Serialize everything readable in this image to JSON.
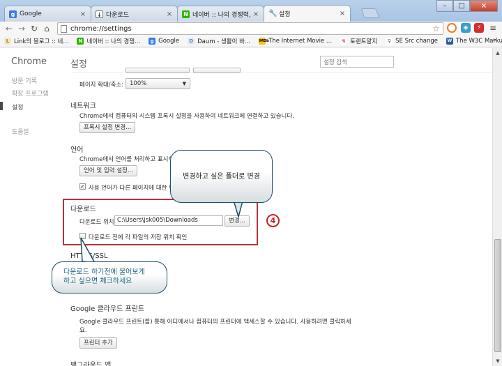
{
  "tabs": [
    {
      "title": "Google",
      "icon": "google-icon"
    },
    {
      "title": "다운로드",
      "icon": "download-icon"
    },
    {
      "title": "네이버 :: 나의 경쟁력, 네",
      "icon": "naver-icon"
    },
    {
      "title": "설정",
      "icon": "wrench-icon"
    }
  ],
  "toolbar": {
    "url": "chrome://settings"
  },
  "bookmarks": [
    {
      "label": "Link의 블로그 :: 네...",
      "icon": "blog-icon"
    },
    {
      "label": "네이버 :: 나의 경쟁...",
      "icon": "naver-icon"
    },
    {
      "label": "Google",
      "icon": "google-icon"
    },
    {
      "label": "Daum - 생활이 바...",
      "icon": "daum-icon"
    },
    {
      "label": "The Internet Movie ...",
      "icon": "imdb-icon"
    },
    {
      "label": "토렌트알지",
      "icon": "torrent-icon"
    },
    {
      "label": "SE Src change",
      "icon": "se-icon"
    },
    {
      "label": "The W3C Markup V...",
      "icon": "w3c-icon"
    }
  ],
  "bookmarks_more": "»",
  "sidebar": {
    "title": "Chrome",
    "items": [
      {
        "label": "방문 기록"
      },
      {
        "label": "확장 프로그램"
      },
      {
        "label": "설정"
      },
      {
        "label": "도움말"
      }
    ]
  },
  "settings": {
    "title": "설정",
    "search_placeholder": "설정 검색",
    "zoom_label": "페이지 확대/축소:",
    "zoom_value": "100%",
    "network": {
      "title": "네트워크",
      "desc": "Chrome에서 컴퓨터의 시스템 프록시 설정을 사용하여 네트워크에 연결하고 있습니다.",
      "button": "프록시 설정 변경..."
    },
    "language": {
      "title": "언어",
      "desc": "Chrome에서 언어를 처리하고 표시하는",
      "button": "언어 및 입력 설정...",
      "translate_label": "사용 언어가 다른 페이지에 대한 번"
    },
    "downloads": {
      "title": "다운로드",
      "location_label": "다운로드 위치:",
      "location_value": "C:\\Users\\jsk005\\Downloads",
      "change_button": "변경...",
      "ask_label": "다운로드 전에 각 파일의 저장 위치 확인"
    },
    "https": {
      "title": "HTTPS/SSL"
    },
    "cloud_print": {
      "title": "Google 클라우드 프린트",
      "desc_line1": "Google 클라우드 프린트(를) 통해 어디에서나 컴퓨터의 프린터에 액세스할 수 있습니다. 사용하려면 클릭하세",
      "desc_line2": "요.",
      "button": "프린터 추가"
    },
    "background": {
      "title": "백그라운드 앱"
    }
  },
  "annotations": {
    "badge": "4",
    "callout_top": "변경하고 싶은 폴더로 변경",
    "callout_bottom_line1": "다운로드 하기전에 물어보게",
    "callout_bottom_line2": "하고 싶으면 체크하세요",
    "border_color": "#b7323a"
  }
}
